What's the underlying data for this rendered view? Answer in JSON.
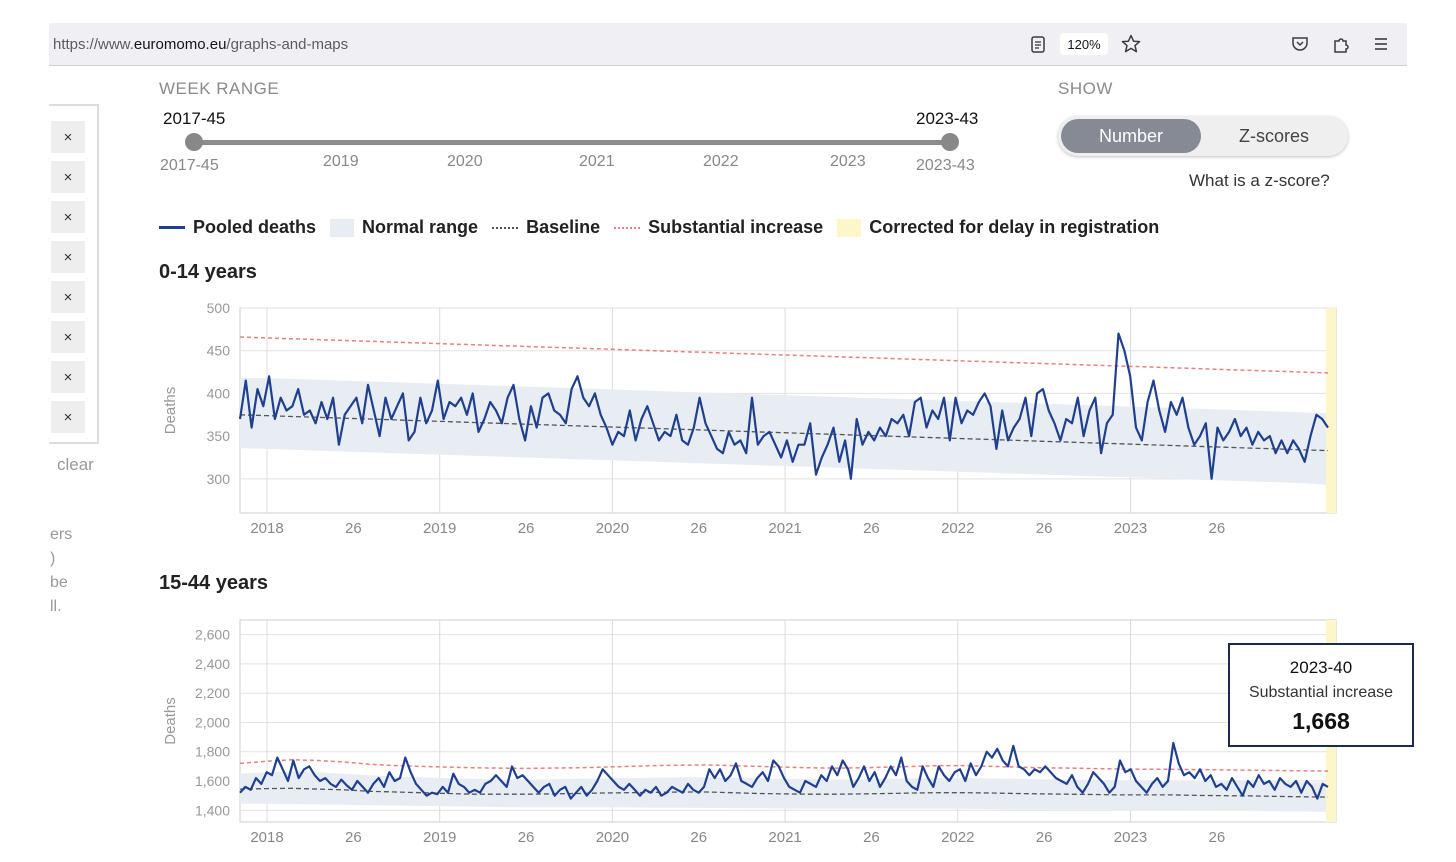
{
  "browser": {
    "url_prefix": "https://www.",
    "url_host": "euromomo.eu",
    "url_path": "/graphs-and-maps",
    "zoom": "120%"
  },
  "sidebar": {
    "remove_label": "×",
    "clear_label": "clear",
    "cut_texts": [
      "ers",
      ")",
      "be",
      "ll."
    ]
  },
  "controls": {
    "week_range_label": "WEEK RANGE",
    "range_start": "2017-45",
    "range_end": "2023-43",
    "range_year_ticks": [
      "2017-45",
      "2019",
      "2020",
      "2021",
      "2022",
      "2023",
      "2023-43"
    ],
    "show_label": "SHOW",
    "show_options": [
      "Number",
      "Z-scores"
    ],
    "show_selected": "Number",
    "zscore_link": "What is a z-score?"
  },
  "legend": {
    "items": [
      "Pooled deaths",
      "Normal range",
      "Baseline",
      "Substantial increase",
      "Corrected for delay in registration"
    ]
  },
  "colors": {
    "pooled": "#1f3f8f",
    "normal_range": "#e8edf3",
    "baseline": "#555555",
    "substantial": "#e88080",
    "corrected": "#fcf6c8"
  },
  "tooltip": {
    "week": "2023-40",
    "label": "Substantial increase",
    "value": "1,668"
  },
  "chart_data": [
    {
      "type": "line",
      "title": "0-14 years",
      "ylabel": "Deaths",
      "ylim": [
        260,
        500
      ],
      "yticks": [
        300,
        350,
        400,
        450,
        500
      ],
      "xticks": [
        "2018",
        "26",
        "2019",
        "26",
        "2020",
        "26",
        "2021",
        "26",
        "2022",
        "26",
        "2023",
        "26"
      ],
      "series": [
        {
          "name": "Pooled deaths",
          "values": [
            370,
            415,
            360,
            405,
            385,
            420,
            370,
            395,
            380,
            385,
            405,
            375,
            380,
            365,
            390,
            370,
            395,
            340,
            375,
            385,
            395,
            365,
            410,
            380,
            350,
            395,
            370,
            385,
            400,
            345,
            355,
            395,
            365,
            380,
            415,
            370,
            390,
            385,
            395,
            375,
            400,
            355,
            370,
            390,
            380,
            365,
            395,
            410,
            370,
            345,
            385,
            360,
            395,
            400,
            380,
            375,
            365,
            405,
            420,
            395,
            385,
            400,
            375,
            360,
            340,
            355,
            350,
            380,
            345,
            370,
            385,
            365,
            345,
            355,
            350,
            375,
            345,
            340,
            360,
            395,
            365,
            350,
            335,
            330,
            355,
            340,
            345,
            330,
            395,
            340,
            350,
            355,
            340,
            325,
            345,
            320,
            340,
            340,
            365,
            305,
            325,
            340,
            360,
            320,
            345,
            300,
            370,
            340,
            355,
            345,
            360,
            350,
            370,
            365,
            375,
            350,
            390,
            395,
            360,
            380,
            370,
            395,
            345,
            395,
            365,
            380,
            375,
            390,
            400,
            385,
            335,
            380,
            345,
            360,
            370,
            395,
            350,
            400,
            405,
            380,
            365,
            345,
            370,
            365,
            395,
            350,
            380,
            395,
            330,
            365,
            375,
            470,
            450,
            420,
            360,
            345,
            390,
            415,
            380,
            355,
            390,
            375,
            395,
            360,
            340,
            350,
            365,
            300,
            360,
            345,
            355,
            370,
            350,
            360,
            340,
            355,
            345,
            350,
            330,
            345,
            330,
            345,
            335,
            320,
            350,
            375,
            370,
            360
          ]
        },
        {
          "name": "Baseline",
          "values": [
            375,
            374,
            373,
            372,
            371,
            370,
            369,
            368,
            367,
            366,
            365,
            364,
            363,
            362,
            361,
            360,
            359,
            358,
            357,
            356,
            355,
            354,
            353,
            352,
            351,
            350,
            349,
            348,
            347,
            346,
            345,
            344,
            343,
            342,
            341,
            340,
            339,
            338,
            337,
            336,
            335,
            334,
            333
          ]
        },
        {
          "name": "Normal range upper",
          "values": [
            418,
            418,
            417,
            416,
            415,
            414,
            413,
            412,
            411,
            410,
            409,
            408,
            407,
            406,
            405,
            404,
            403,
            402,
            401,
            400,
            399,
            398,
            397,
            396,
            395,
            394,
            393,
            392,
            391,
            390,
            389,
            388,
            387,
            386,
            385,
            384,
            383,
            382,
            381,
            380,
            379,
            378,
            377
          ]
        },
        {
          "name": "Normal range lower",
          "values": [
            336,
            335,
            334,
            333,
            332,
            331,
            330,
            329,
            328,
            327,
            326,
            325,
            324,
            323,
            322,
            321,
            320,
            319,
            318,
            317,
            316,
            315,
            314,
            313,
            312,
            311,
            310,
            309,
            308,
            307,
            306,
            305,
            304,
            303,
            302,
            301,
            300,
            299,
            298,
            297,
            296,
            295,
            293
          ]
        },
        {
          "name": "Substantial increase",
          "values": [
            466,
            465,
            464,
            463,
            462,
            461,
            460,
            459,
            458,
            457,
            456,
            455,
            454,
            453,
            452,
            451,
            450,
            449,
            448,
            447,
            446,
            445,
            444,
            443,
            442,
            441,
            440,
            439,
            438,
            437,
            436,
            435,
            434,
            433,
            432,
            431,
            430,
            429,
            428,
            427,
            426,
            425,
            424
          ]
        }
      ]
    },
    {
      "type": "line",
      "title": "15-44 years",
      "ylabel": "Deaths",
      "ylim": [
        1320,
        2700
      ],
      "yticks": [
        1400,
        1600,
        1800,
        2000,
        2200,
        2400,
        2600
      ],
      "xticks": [
        "2018",
        "26",
        "2019",
        "26",
        "2020",
        "26",
        "2021",
        "26",
        "2022",
        "26",
        "2023",
        "26"
      ],
      "series": [
        {
          "name": "Pooled deaths",
          "values": [
            1520,
            1560,
            1540,
            1620,
            1580,
            1660,
            1640,
            1760,
            1680,
            1600,
            1740,
            1620,
            1680,
            1700,
            1640,
            1600,
            1620,
            1580,
            1560,
            1610,
            1570,
            1540,
            1600,
            1560,
            1520,
            1580,
            1620,
            1560,
            1660,
            1600,
            1620,
            1760,
            1660,
            1580,
            1540,
            1500,
            1520,
            1510,
            1560,
            1520,
            1650,
            1580,
            1560,
            1520,
            1540,
            1520,
            1580,
            1600,
            1640,
            1600,
            1560,
            1700,
            1620,
            1640,
            1600,
            1560,
            1520,
            1560,
            1580,
            1500,
            1540,
            1560,
            1480,
            1520,
            1560,
            1500,
            1540,
            1600,
            1680,
            1640,
            1600,
            1560,
            1540,
            1580,
            1540,
            1500,
            1540,
            1520,
            1560,
            1500,
            1520,
            1560,
            1540,
            1520,
            1580,
            1540,
            1520,
            1560,
            1680,
            1620,
            1680,
            1600,
            1640,
            1720,
            1600,
            1580,
            1560,
            1620,
            1660,
            1600,
            1740,
            1700,
            1620,
            1560,
            1540,
            1520,
            1600,
            1580,
            1560,
            1640,
            1600,
            1700,
            1640,
            1740,
            1680,
            1560,
            1620,
            1700,
            1600,
            1660,
            1560,
            1620,
            1700,
            1640,
            1760,
            1600,
            1560,
            1540,
            1700,
            1620,
            1560,
            1700,
            1640,
            1600,
            1660,
            1680,
            1600,
            1720,
            1640,
            1700,
            1800,
            1760,
            1820,
            1740,
            1700,
            1840,
            1700,
            1680,
            1640,
            1680,
            1660,
            1700,
            1660,
            1620,
            1600,
            1580,
            1640,
            1560,
            1520,
            1580,
            1660,
            1620,
            1580,
            1520,
            1560,
            1740,
            1660,
            1680,
            1600,
            1560,
            1520,
            1580,
            1620,
            1560,
            1600,
            1860,
            1720,
            1640,
            1660,
            1620,
            1680,
            1600,
            1640,
            1560,
            1580,
            1540,
            1620,
            1560,
            1500,
            1600,
            1560,
            1640,
            1580,
            1600,
            1540,
            1620,
            1580,
            1560,
            1600,
            1520,
            1600,
            1560,
            1480,
            1580,
            1560
          ]
        },
        {
          "name": "Baseline",
          "values": [
            1545,
            1548,
            1550,
            1545,
            1540,
            1530,
            1525,
            1520,
            1515,
            1510,
            1510,
            1510,
            1512,
            1515,
            1518,
            1520,
            1522,
            1525,
            1525,
            1520,
            1515,
            1512,
            1510,
            1510,
            1512,
            1515,
            1518,
            1520,
            1520,
            1518,
            1515,
            1512,
            1510,
            1508,
            1505,
            1505,
            1505,
            1502,
            1500,
            1498,
            1495,
            1492,
            1490
          ]
        },
        {
          "name": "Normal range upper",
          "values": [
            1650,
            1660,
            1665,
            1660,
            1650,
            1640,
            1630,
            1625,
            1620,
            1615,
            1612,
            1610,
            1612,
            1615,
            1618,
            1620,
            1622,
            1625,
            1625,
            1622,
            1618,
            1615,
            1612,
            1610,
            1612,
            1615,
            1618,
            1620,
            1620,
            1618,
            1615,
            1612,
            1610,
            1608,
            1605,
            1605,
            1605,
            1602,
            1600,
            1598,
            1595,
            1592,
            1590
          ]
        },
        {
          "name": "Normal range lower",
          "values": [
            1445,
            1445,
            1442,
            1440,
            1438,
            1435,
            1432,
            1430,
            1428,
            1425,
            1422,
            1420,
            1420,
            1420,
            1420,
            1420,
            1418,
            1418,
            1416,
            1415,
            1414,
            1412,
            1410,
            1410,
            1410,
            1410,
            1410,
            1410,
            1410,
            1408,
            1406,
            1405,
            1404,
            1402,
            1400,
            1400,
            1400,
            1398,
            1396,
            1395,
            1394,
            1392,
            1390
          ]
        },
        {
          "name": "Substantial increase",
          "values": [
            1720,
            1735,
            1745,
            1740,
            1730,
            1715,
            1705,
            1700,
            1695,
            1690,
            1688,
            1686,
            1688,
            1690,
            1695,
            1700,
            1705,
            1708,
            1710,
            1705,
            1700,
            1695,
            1690,
            1688,
            1690,
            1695,
            1700,
            1705,
            1705,
            1700,
            1695,
            1690,
            1688,
            1685,
            1682,
            1680,
            1680,
            1678,
            1676,
            1674,
            1672,
            1670,
            1668
          ]
        }
      ]
    }
  ]
}
